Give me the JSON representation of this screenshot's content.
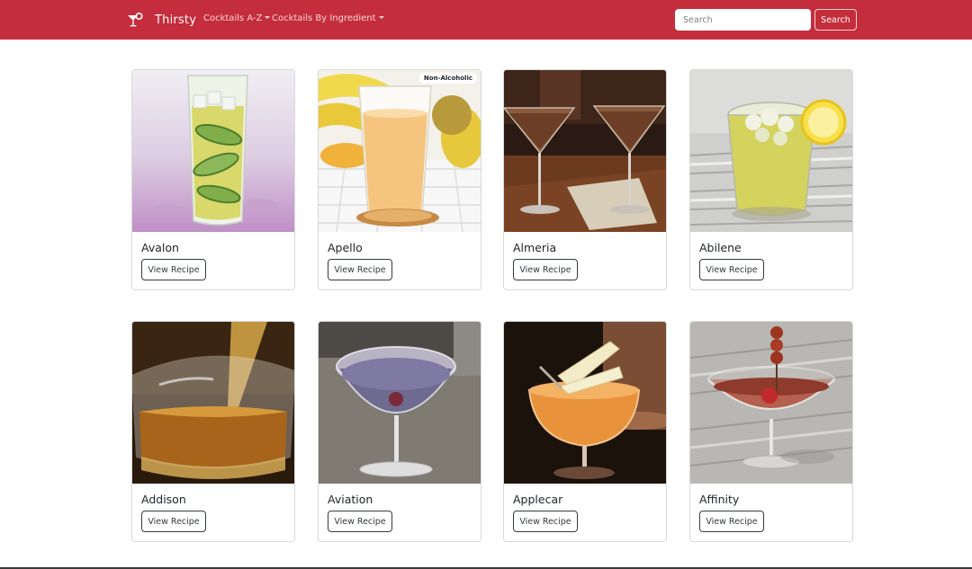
{
  "navbar": {
    "brand": "Thirsty",
    "links": [
      {
        "label": "Cocktails A-Z"
      },
      {
        "label": "Cocktails By Ingredient"
      }
    ],
    "search": {
      "placeholder": "Search",
      "value": "",
      "button_label": "Search"
    },
    "colors": {
      "background": "#c42d3b",
      "text": "#ffffff"
    }
  },
  "cards": [
    {
      "name": "Avalon",
      "button_label": "View Recipe",
      "badge": "",
      "image": "highball-cucumber-drink"
    },
    {
      "name": "Apello",
      "button_label": "View Recipe",
      "badge": "Non-Alcoholic",
      "image": "juice-glass-with-bananas"
    },
    {
      "name": "Almeria",
      "button_label": "View Recipe",
      "badge": "",
      "image": "two-martini-glasses"
    },
    {
      "name": "Abilene",
      "button_label": "View Recipe",
      "badge": "",
      "image": "iced-lemon-drink"
    },
    {
      "name": "Addison",
      "button_label": "View Recipe",
      "badge": "",
      "image": "pouring-amber-drink"
    },
    {
      "name": "Aviation",
      "button_label": "View Recipe",
      "badge": "",
      "image": "purple-cocktail-glass"
    },
    {
      "name": "Applecar",
      "button_label": "View Recipe",
      "badge": "",
      "image": "apple-garnish-cocktail"
    },
    {
      "name": "Affinity",
      "button_label": "View Recipe",
      "badge": "",
      "image": "cherry-garnish-cocktail"
    }
  ]
}
